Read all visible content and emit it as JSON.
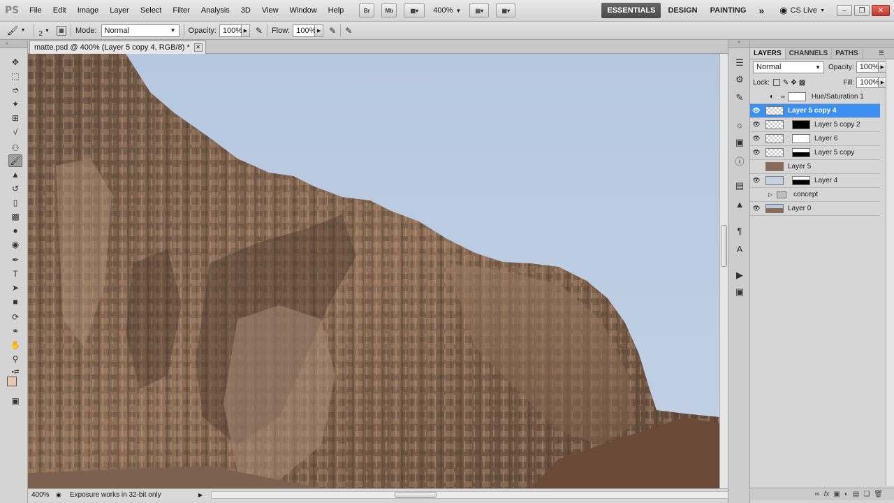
{
  "app": {
    "logo": "PS"
  },
  "menu": [
    "File",
    "Edit",
    "Image",
    "Layer",
    "Select",
    "Filter",
    "Analysis",
    "3D",
    "View",
    "Window",
    "Help"
  ],
  "appbar": {
    "bridge": "Br",
    "minibridge": "Mb",
    "zoom": "400%"
  },
  "workspaces": {
    "essentials": "ESSENTIALS",
    "design": "DESIGN",
    "painting": "PAINTING",
    "more": "»"
  },
  "cslive": "CS Live",
  "options": {
    "brush_size": "2",
    "mode_label": "Mode:",
    "mode_value": "Normal",
    "opacity_label": "Opacity:",
    "opacity_value": "100%",
    "flow_label": "Flow:",
    "flow_value": "100%"
  },
  "document": {
    "tab_title": "matte.psd @ 400% (Layer 5 copy 4, RGB/8) *",
    "zoom": "400%",
    "status": "Exposure works in 32-bit only"
  },
  "layers_panel": {
    "tabs": [
      "LAYERS",
      "CHANNELS",
      "PATHS"
    ],
    "blend_mode": "Normal",
    "opacity_label": "Opacity:",
    "opacity_value": "100%",
    "lock_label": "Lock:",
    "fill_label": "Fill:",
    "fill_value": "100%",
    "layers": [
      {
        "name": "Hue/Saturation 1",
        "visible": false,
        "selected": false
      },
      {
        "name": "Layer 5 copy 4",
        "visible": true,
        "selected": true
      },
      {
        "name": "Layer 5 copy 2",
        "visible": true,
        "selected": false
      },
      {
        "name": "Layer 6",
        "visible": true,
        "selected": false
      },
      {
        "name": "Layer 5 copy",
        "visible": true,
        "selected": false
      },
      {
        "name": "Layer 5",
        "visible": false,
        "selected": false
      },
      {
        "name": "Layer 4",
        "visible": true,
        "selected": false
      },
      {
        "name": "concept",
        "visible": false,
        "selected": false
      },
      {
        "name": "Layer 0",
        "visible": true,
        "selected": false
      }
    ]
  },
  "colors": {
    "selection": "#3d8ff2",
    "sky": "#b7c9df",
    "rock": "#8c6b52"
  }
}
